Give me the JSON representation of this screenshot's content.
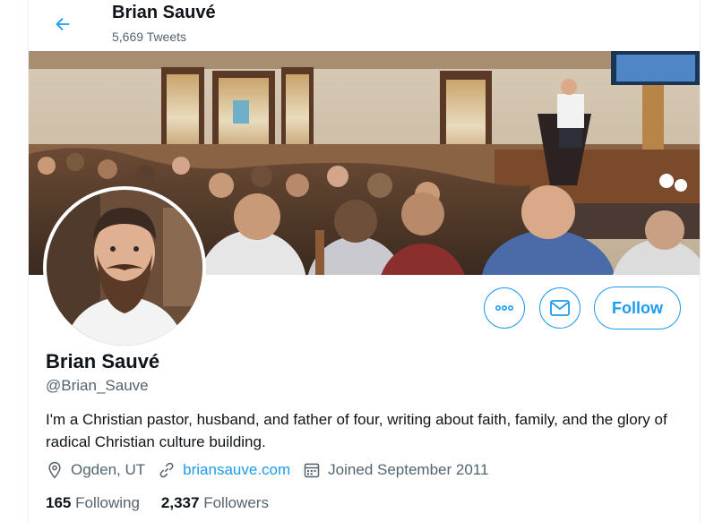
{
  "header": {
    "name": "Brian Sauvé",
    "tweet_count": "5,669 Tweets"
  },
  "profile": {
    "name": "Brian Sauvé",
    "handle": "@Brian_Sauve",
    "bio": "I'm a Christian pastor, husband, and father of four, writing about faith, family, and the glory of radical Christian culture building.",
    "location": "Ogden, UT",
    "website": "briansauve.com",
    "joined": "Joined September 2011",
    "following_count": "165",
    "following_label": "Following",
    "followers_count": "2,337",
    "followers_label": "Followers"
  },
  "actions": {
    "follow_label": "Follow"
  },
  "icons": {
    "back": "arrow-left-icon",
    "more": "more-icon",
    "message": "envelope-icon",
    "location": "location-pin-icon",
    "link": "link-icon",
    "calendar": "calendar-icon"
  },
  "colors": {
    "accent": "#1d9bf0",
    "text_primary": "#0f1419",
    "text_secondary": "#536471"
  }
}
